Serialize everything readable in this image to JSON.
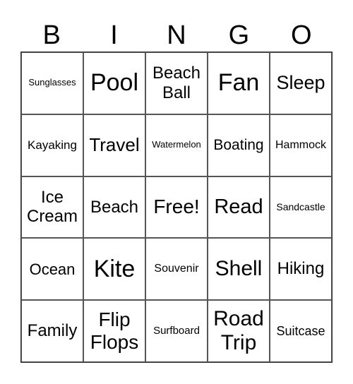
{
  "header": [
    "B",
    "I",
    "N",
    "G",
    "O"
  ],
  "cells": [
    {
      "text": "Sunglasses",
      "size": "sm13"
    },
    {
      "text": "Pool",
      "size": "xl34"
    },
    {
      "text": "Beach\nBall",
      "size": "l24"
    },
    {
      "text": "Fan",
      "size": "xl34"
    },
    {
      "text": "Sleep",
      "size": "l27"
    },
    {
      "text": "Kayaking",
      "size": "m17"
    },
    {
      "text": "Travel",
      "size": "l26"
    },
    {
      "text": "Watermelon",
      "size": "sm13"
    },
    {
      "text": "Boating",
      "size": "m21"
    },
    {
      "text": "Hammock",
      "size": "m16"
    },
    {
      "text": "Ice\nCream",
      "size": "l24"
    },
    {
      "text": "Beach",
      "size": "l24"
    },
    {
      "text": "Free!",
      "size": "l28"
    },
    {
      "text": "Read",
      "size": "l29"
    },
    {
      "text": "Sandcastle",
      "size": "sm14"
    },
    {
      "text": "Ocean",
      "size": "m22"
    },
    {
      "text": "Kite",
      "size": "xl34"
    },
    {
      "text": "Souvenir",
      "size": "m16"
    },
    {
      "text": "Shell",
      "size": "l30"
    },
    {
      "text": "Hiking",
      "size": "l24"
    },
    {
      "text": "Family",
      "size": "l24"
    },
    {
      "text": "Flip\nFlops",
      "size": "l28"
    },
    {
      "text": "Surfboard",
      "size": "sm15"
    },
    {
      "text": "Road\nTrip",
      "size": "l30"
    },
    {
      "text": "Suitcase",
      "size": "m18"
    }
  ]
}
